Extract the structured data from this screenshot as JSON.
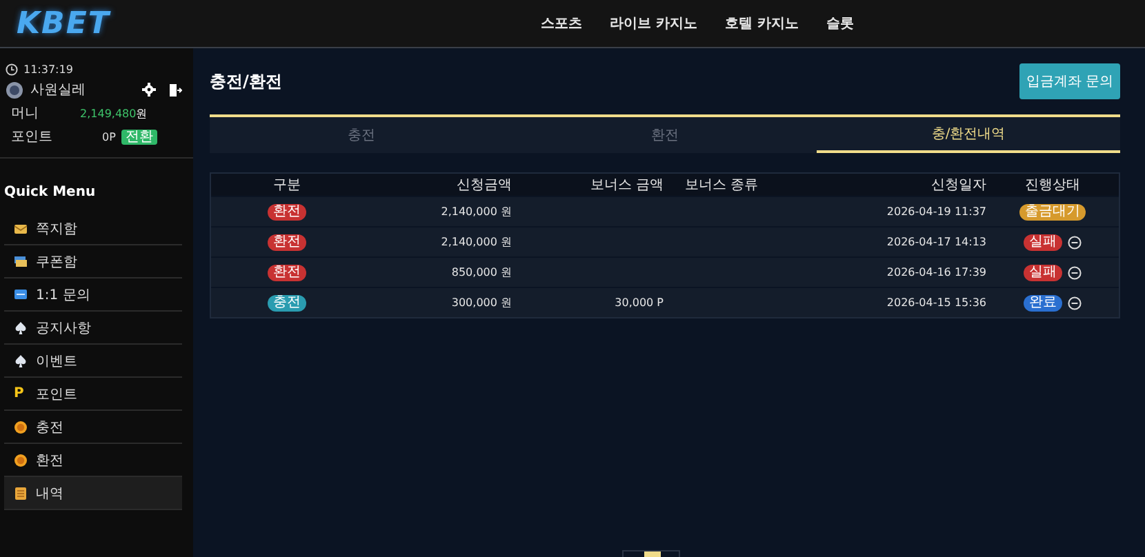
{
  "header": {
    "logo": "KBET",
    "nav": [
      {
        "label": "스포츠"
      },
      {
        "label": "라이브 카지노"
      },
      {
        "label": "호텔 카지노"
      },
      {
        "label": "슬롯"
      }
    ]
  },
  "sidebar": {
    "time": "11:37:19",
    "user": {
      "name": "사원실레",
      "money_label": "머니",
      "money_value": "2,149,480",
      "money_unit": "원",
      "point_label": "포인트",
      "point_value": "0P",
      "convert_button": "전환"
    },
    "menu_title": "Quick Menu",
    "items": [
      {
        "label": "쪽지함",
        "kind": "envelope",
        "selected": false
      },
      {
        "label": "쿠폰함",
        "kind": "coupon",
        "selected": false
      },
      {
        "label": "1:1 문의",
        "kind": "chat",
        "selected": false
      },
      {
        "label": "공지사항",
        "kind": "club",
        "selected": false
      },
      {
        "label": "이벤트",
        "kind": "club",
        "selected": false
      },
      {
        "label": "포인트",
        "kind": "point",
        "icon_text": "P",
        "selected": false
      },
      {
        "label": "충전",
        "kind": "coin",
        "selected": false
      },
      {
        "label": "환전",
        "kind": "coin",
        "selected": false
      },
      {
        "label": "내역",
        "kind": "list",
        "selected": true
      }
    ]
  },
  "main": {
    "title": "충전/환전",
    "inquiry_button": "입금계좌 문의",
    "tabs": [
      {
        "label": "충전",
        "selected": false
      },
      {
        "label": "환전",
        "selected": false
      },
      {
        "label": "충/환전내역",
        "selected": true
      }
    ],
    "table": {
      "columns": [
        "구분",
        "신청금액",
        "보너스 금액",
        "보너스 종류",
        "신청일자",
        "진행상태"
      ],
      "rows": [
        {
          "type": {
            "label": "환전",
            "color": "#c83232"
          },
          "amount": "2,140,000 원",
          "date": "2026-04-19 11:37",
          "status": {
            "label": "출금대기",
            "color": "#d69a2d"
          },
          "cancel_icon": false
        },
        {
          "type": {
            "label": "환전",
            "color": "#c83232"
          },
          "amount": "2,140,000 원",
          "date": "2026-04-17 14:13",
          "status": {
            "label": "실패",
            "color": "#c83232"
          },
          "cancel_icon": true
        },
        {
          "type": {
            "label": "환전",
            "color": "#c83232"
          },
          "amount": "850,000 원",
          "date": "2026-04-16 17:39",
          "status": {
            "label": "실패",
            "color": "#c83232"
          },
          "cancel_icon": true
        },
        {
          "type": {
            "label": "충전",
            "color": "#2a9cb0"
          },
          "amount": "300,000 원",
          "bonus": "30,000 P",
          "date": "2026-04-15 15:36",
          "status": {
            "label": "완료",
            "color": "#2a6fd0"
          },
          "cancel_icon": true
        }
      ]
    }
  }
}
